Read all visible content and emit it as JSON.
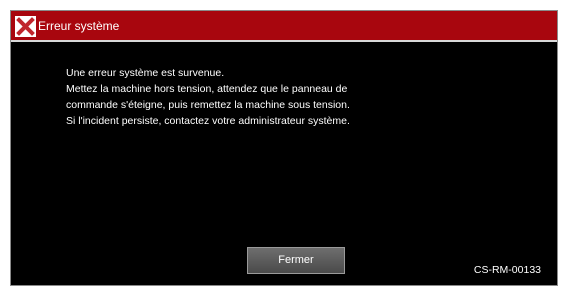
{
  "dialog": {
    "title": "Erreur système",
    "icon": "error-x-icon",
    "message_lines": [
      "Une erreur système est survenue.",
      "Mettez la machine hors tension, attendez que le panneau de",
      "commande s'éteigne, puis remettez la machine sous tension.",
      "Si l'incident persiste, contactez votre administrateur système."
    ],
    "close_label": "Fermer",
    "error_code": "CS-RM-00133"
  },
  "colors": {
    "titlebar": "#a8060e",
    "background": "#000000",
    "text": "#ffffff",
    "icon_x": "#c0262d"
  }
}
